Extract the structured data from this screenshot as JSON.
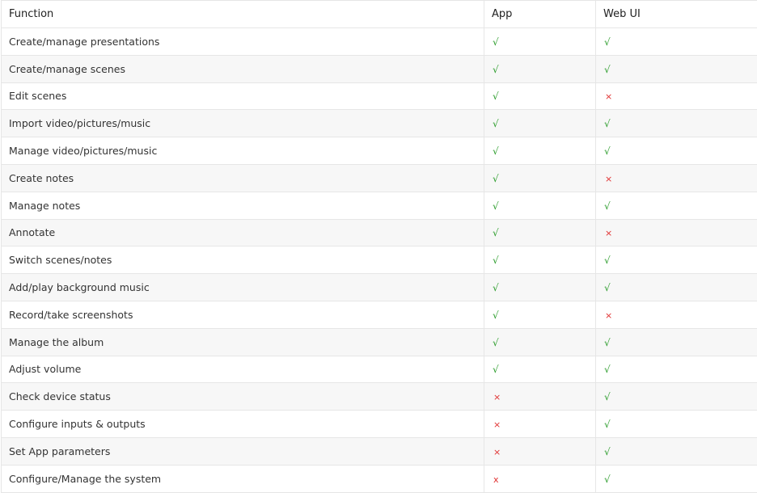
{
  "headers": {
    "function": "Function",
    "app": "App",
    "web_ui": "Web UI"
  },
  "symbols": {
    "yes": "√",
    "no": "×"
  },
  "colors": {
    "yes": "#2e9e2e",
    "no": "#e03030"
  },
  "rows": [
    {
      "function": "Create/manage presentations",
      "app": "√",
      "web_ui": "√"
    },
    {
      "function": "Create/manage scenes",
      "app": "√",
      "web_ui": "√"
    },
    {
      "function": "Edit scenes",
      "app": "√",
      "web_ui": "×"
    },
    {
      "function": "Import video/pictures/music",
      "app": "√",
      "web_ui": "√"
    },
    {
      "function": "Manage video/pictures/music",
      "app": "√",
      "web_ui": "√"
    },
    {
      "function": "Create notes",
      "app": "√",
      "web_ui": "×"
    },
    {
      "function": "Manage notes",
      "app": "√",
      "web_ui": "√"
    },
    {
      "function": "Annotate",
      "app": "√",
      "web_ui": "×"
    },
    {
      "function": "Switch scenes/notes",
      "app": "√",
      "web_ui": "√"
    },
    {
      "function": "Add/play background music",
      "app": "√",
      "web_ui": "√"
    },
    {
      "function": "Record/take screenshots",
      "app": "√",
      "web_ui": "×"
    },
    {
      "function": "Manage the album",
      "app": "√",
      "web_ui": "√"
    },
    {
      "function": "Adjust volume",
      "app": "√",
      "web_ui": "√"
    },
    {
      "function": "Check device status",
      "app": "×",
      "web_ui": "√"
    },
    {
      "function": "Configure inputs & outputs",
      "app": "×",
      "web_ui": "√"
    },
    {
      "function": "Set App parameters",
      "app": "×",
      "web_ui": "√"
    },
    {
      "function": "Configure/Manage the system",
      "app": "x",
      "web_ui": "√"
    }
  ]
}
